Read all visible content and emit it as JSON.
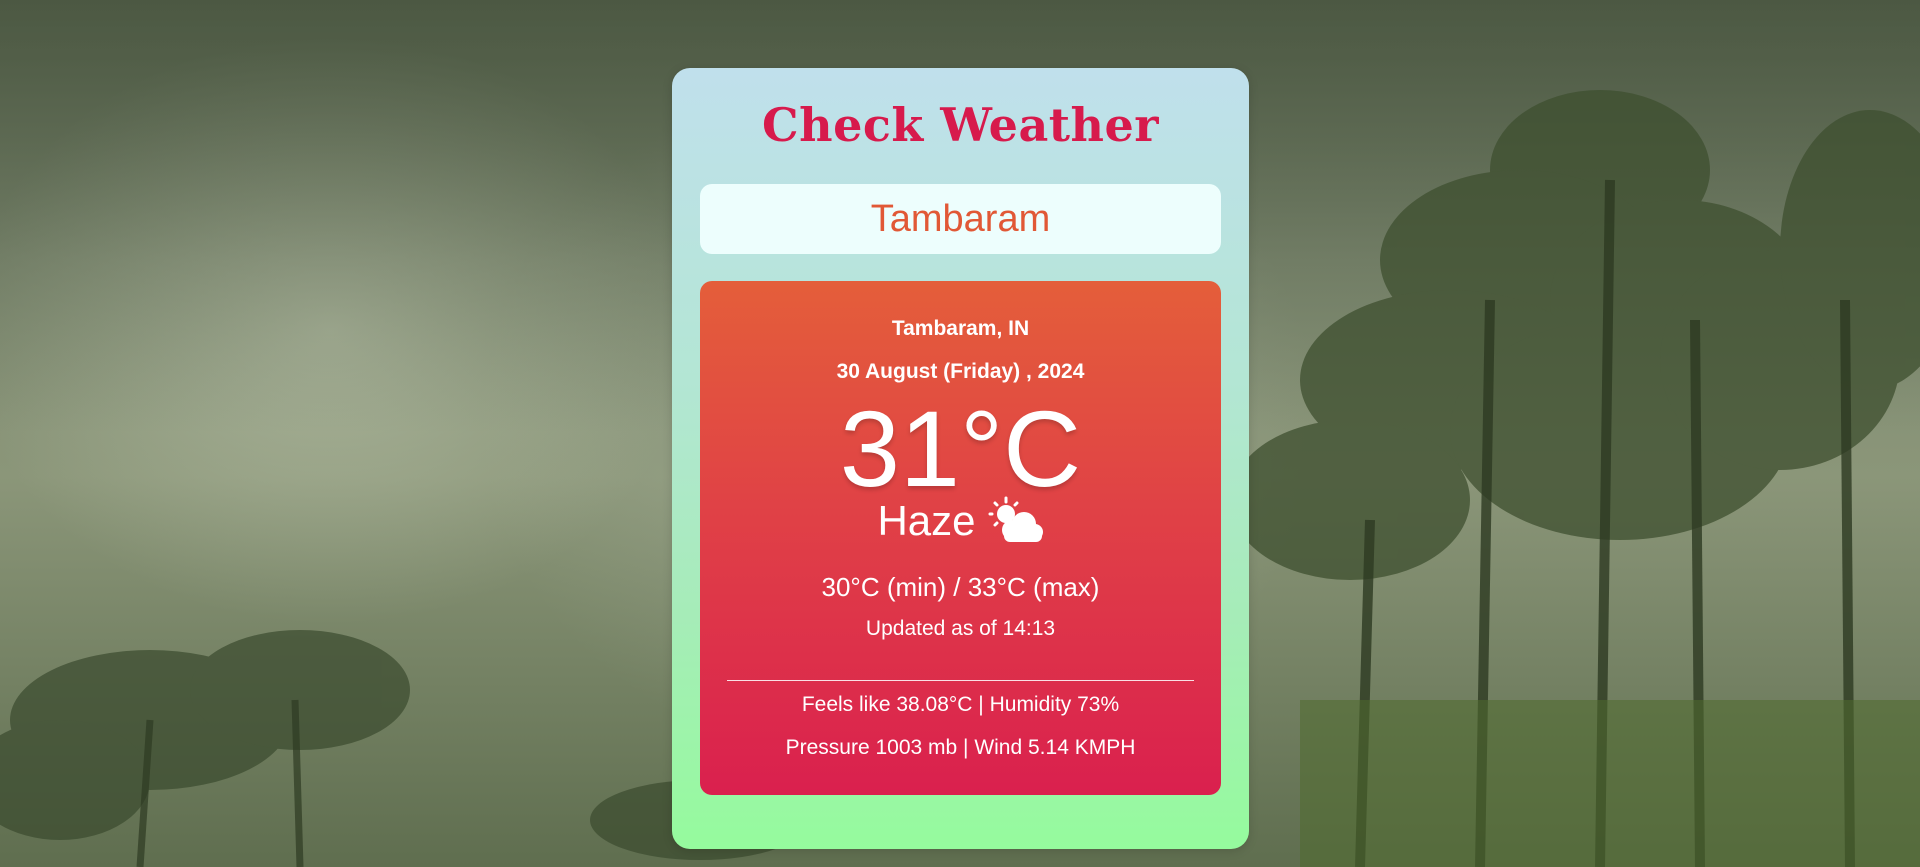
{
  "app": {
    "title": "Check Weather"
  },
  "search": {
    "value": "Tambaram"
  },
  "weather": {
    "location": "Tambaram, IN",
    "date": "30 August (Friday) , 2024",
    "temperature": "31°C",
    "condition": "Haze",
    "condition_icon": "sun-behind-cloud-icon",
    "min_max": "30°C (min) / 33°C (max)",
    "updated": "Updated as of 14:13",
    "feels_humidity": "Feels like 38.08°C | Humidity 73%",
    "pressure_wind": "Pressure 1003 mb | Wind 5.14 KMPH"
  },
  "colors": {
    "title": "#d71a4c",
    "search_text": "#e15836",
    "panel_top": "#e45e3a",
    "panel_bottom": "#da204e",
    "card_top": "#c0e0ec",
    "card_bottom": "#95fb9d"
  }
}
